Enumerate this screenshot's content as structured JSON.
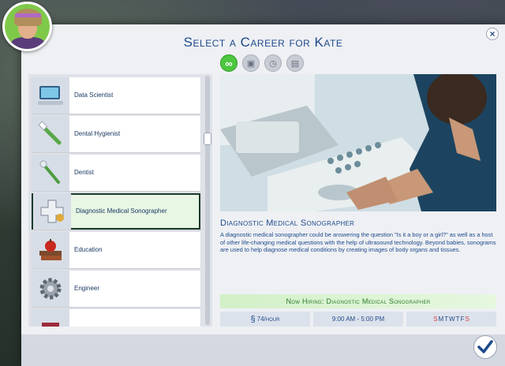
{
  "dialog": {
    "title": "Select a Career for Kate",
    "close_label": "×"
  },
  "filters": [
    {
      "icon": "infinity-icon",
      "glyph": "∞",
      "active": true
    },
    {
      "icon": "career-type-icon",
      "glyph": "▣",
      "active": false
    },
    {
      "icon": "part-time-icon",
      "glyph": "◷",
      "active": false
    },
    {
      "icon": "freelance-icon",
      "glyph": "▤",
      "active": false
    }
  ],
  "careers": [
    {
      "label": "Data Scientist",
      "icon": "computer-icon"
    },
    {
      "label": "Dental Hygienist",
      "icon": "toothbrush-icon"
    },
    {
      "label": "Dentist",
      "icon": "dental-tool-icon"
    },
    {
      "label": "Diagnostic Medical Sonographer",
      "icon": "medical-cross-icon",
      "selected": true
    },
    {
      "label": "Education",
      "icon": "books-apple-icon"
    },
    {
      "label": "Engineer",
      "icon": "gear-icon"
    }
  ],
  "details": {
    "title": "Diagnostic Medical Sonographer",
    "description": "A diagnostic medical sonographer could be answering the question \"Is it a boy or a girl?\" as well as a host of other life-changing medical questions with the help of ultrasound technology. Beyond babies, sonograms are used to help diagnose medical conditions by creating images of body organs and tissues.",
    "hiring": "Now Hiring: Diagnostic Medical Sonographer",
    "pay_symbol": "§",
    "pay": "74/hour",
    "hours": "9:00 AM - 5:00 PM",
    "days": [
      {
        "d": "S",
        "work": false
      },
      {
        "d": "M",
        "work": true
      },
      {
        "d": "T",
        "work": true
      },
      {
        "d": "W",
        "work": true
      },
      {
        "d": "T",
        "work": true
      },
      {
        "d": "F",
        "work": true
      },
      {
        "d": "S",
        "work": false
      }
    ]
  },
  "colors": {
    "accent": "#1f4a8a",
    "hiring_text": "#2b7a2a",
    "weekend": "#d23c3c",
    "filter_active": "#4cc63f"
  }
}
